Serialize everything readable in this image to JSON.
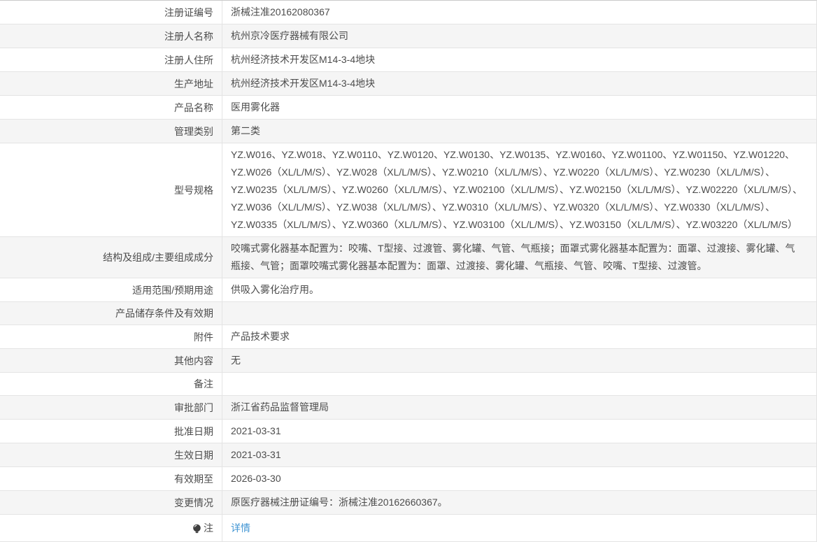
{
  "colors": {
    "link": "#4195d3",
    "stripe": "#f5f5f5",
    "border": "#e4e4e4",
    "text": "#4c4c4c",
    "icon": "#3f3f3f"
  },
  "icons": {
    "note_icon": "lightbulb-icon"
  },
  "table": {
    "rows": [
      {
        "label": "注册证编号",
        "value": "浙械注准20162080367"
      },
      {
        "label": "注册人名称",
        "value": "杭州京冷医疗器械有限公司"
      },
      {
        "label": "注册人住所",
        "value": "杭州经济技术开发区M14-3-4地块"
      },
      {
        "label": "生产地址",
        "value": "杭州经济技术开发区M14-3-4地块"
      },
      {
        "label": "产品名称",
        "value": "医用雾化器"
      },
      {
        "label": "管理类别",
        "value": "第二类"
      },
      {
        "label": "型号规格",
        "value": "YZ.W016、YZ.W018、YZ.W0110、YZ.W0120、YZ.W0130、YZ.W0135、YZ.W0160、YZ.W01100、YZ.W01150、YZ.W01220、YZ.W026（XL/L/M/S）、YZ.W028（XL/L/M/S）、YZ.W0210（XL/L/M/S）、YZ.W0220（XL/L/M/S）、YZ.W0230（XL/L/M/S）、YZ.W0235（XL/L/M/S）、YZ.W0260（XL/L/M/S）、YZ.W02100（XL/L/M/S）、YZ.W02150（XL/L/M/S）、YZ.W02220（XL/L/M/S）、YZ.W036（XL/L/M/S）、YZ.W038（XL/L/M/S）、YZ.W0310（XL/L/M/S）、YZ.W0320（XL/L/M/S）、YZ.W0330（XL/L/M/S）、YZ.W0335（XL/L/M/S）、YZ.W0360（XL/L/M/S）、YZ.W03100（XL/L/M/S）、YZ.W03150（XL/L/M/S）、YZ.W03220（XL/L/M/S）"
      },
      {
        "label": "结构及组成/主要组成成分",
        "value": "咬嘴式雾化器基本配置为：咬嘴、T型接、过渡管、雾化罐、气管、气瓶接；面罩式雾化器基本配置为：面罩、过渡接、雾化罐、气瓶接、气管；面罩咬嘴式雾化器基本配置为：面罩、过渡接、雾化罐、气瓶接、气管、咬嘴、T型接、过渡管。"
      },
      {
        "label": "适用范围/预期用途",
        "value": "供吸入雾化治疗用。"
      },
      {
        "label": "产品储存条件及有效期",
        "value": ""
      },
      {
        "label": "附件",
        "value": "产品技术要求"
      },
      {
        "label": "其他内容",
        "value": "无"
      },
      {
        "label": "备注",
        "value": ""
      },
      {
        "label": "审批部门",
        "value": "浙江省药品监督管理局"
      },
      {
        "label": "批准日期",
        "value": "2021-03-31"
      },
      {
        "label": "生效日期",
        "value": "2021-03-31"
      },
      {
        "label": "有效期至",
        "value": "2026-03-30"
      },
      {
        "label": "变更情况",
        "value": "原医疗器械注册证编号：浙械注准20162660367。"
      },
      {
        "label": "注",
        "value": "",
        "icon": true,
        "link": "详情"
      }
    ]
  }
}
